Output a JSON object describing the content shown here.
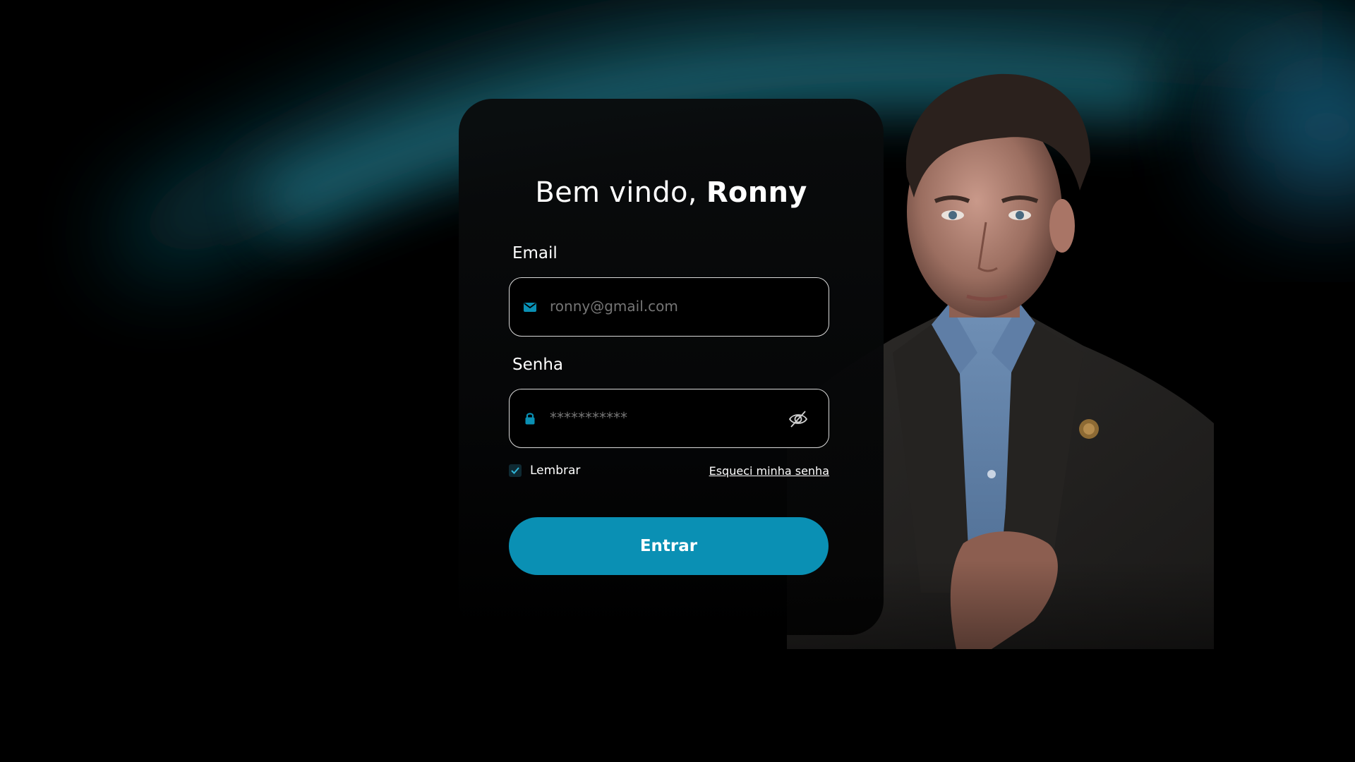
{
  "greeting": {
    "prefix": "Bem vindo,",
    "name": "Ronny"
  },
  "email": {
    "label": "Email",
    "placeholder": "ronny@gmail.com",
    "icon": "mail-icon"
  },
  "password": {
    "label": "Senha",
    "placeholder": "***********",
    "icon": "lock-icon",
    "toggle_icon": "eye-off-icon"
  },
  "remember": {
    "label": "Lembrar",
    "checked": true
  },
  "forgot_link": "Esqueci minha senha",
  "submit_label": "Entrar",
  "colors": {
    "accent": "#0a90b4",
    "background": "#000000",
    "glow": "#1a6f80"
  }
}
